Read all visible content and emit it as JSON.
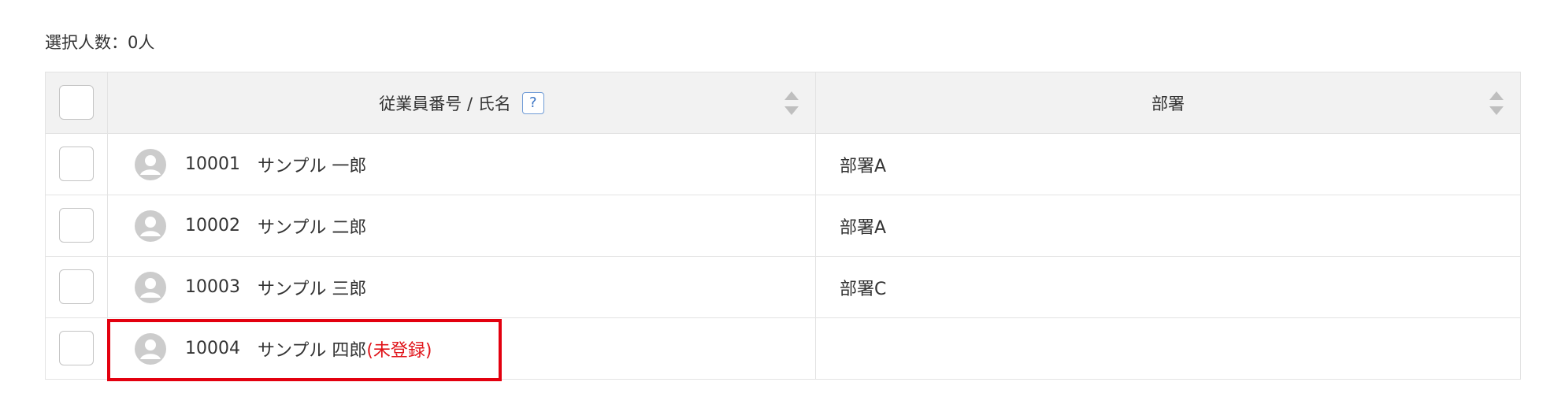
{
  "selected_count": {
    "label": "選択人数：",
    "value": "0人"
  },
  "table": {
    "headers": {
      "employee": "従業員番号 / 氏名",
      "help": "?",
      "department": "部署"
    },
    "rows": [
      {
        "emp_no": "10001",
        "name": "サンプル 一郎",
        "status": "",
        "department": "部署A"
      },
      {
        "emp_no": "10002",
        "name": "サンプル 二郎",
        "status": "",
        "department": "部署A"
      },
      {
        "emp_no": "10003",
        "name": "サンプル 三郎",
        "status": "",
        "department": "部署C"
      },
      {
        "emp_no": "10004",
        "name": "サンプル 四郎",
        "status": "(未登録)",
        "department": ""
      }
    ]
  },
  "icons": {
    "avatar": "user-avatar-icon",
    "help": "help-icon",
    "sort": "sort-icon"
  },
  "colors": {
    "header_bg": "#f2f2f2",
    "border": "#e3e3e3",
    "highlight": "#e3000f",
    "unregistered_text": "#e0141a",
    "help_accent": "#3b74c4"
  }
}
